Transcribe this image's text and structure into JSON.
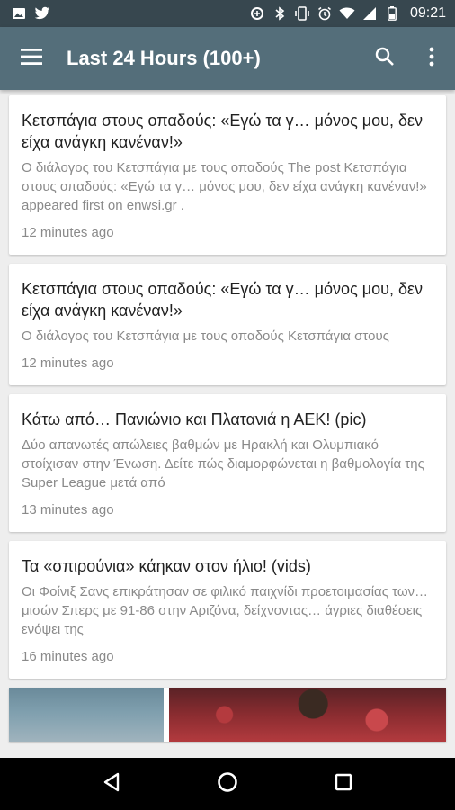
{
  "status_bar": {
    "time": "09:21",
    "left_icons": [
      "image-icon",
      "twitter-icon"
    ],
    "right_icons": [
      "data-saver-icon",
      "bluetooth-icon",
      "vibrate-icon",
      "alarm-icon",
      "wifi-icon",
      "signal-icon",
      "battery-icon"
    ]
  },
  "app_bar": {
    "title": "Last 24 Hours (100+)",
    "menu_icon": "hamburger-menu-icon",
    "search_icon": "search-icon",
    "more_icon": "more-vert-icon",
    "background": "#546e7a"
  },
  "feed": {
    "items": [
      {
        "title": "Κετσπάγια στους οπαδούς: «Εγώ τα γ… μόνος μου, δεν είχα ανάγκη κανέναν!»",
        "summary": "Ο διάλογος του Κετσπάγια με τους οπαδούς The post Κετσπάγια στους οπαδούς: «Εγώ τα γ… μόνος μου, δεν είχα ανάγκη κανέναν!» appeared first on enwsi.gr .",
        "time": "12 minutes ago"
      },
      {
        "title": "Κετσπάγια στους οπαδούς: «Εγώ τα γ… μόνος μου, δεν είχα ανάγκη κανέναν!»",
        "summary": "Ο διάλογος του Κετσπάγια με τους οπαδούς Κετσπάγια στους",
        "time": "12 minutes ago"
      },
      {
        "title": "Κάτω από… Πανιώνιο και Πλατανιά η ΑΕΚ! (pic)",
        "summary": "Δύο απανωτές απώλειες βαθμών με Ηρακλή και Ολυμπιακό στοίχισαν στην Ένωση. Δείτε πώς διαμορφώνεται η βαθμολογία της Super League μετά από",
        "time": "13 minutes ago"
      },
      {
        "title": "Τα «σπιρούνια» κάηκαν στον ήλιο! (vids)",
        "summary": "Οι Φοίνιξ Σανς επικράτησαν σε φιλικό παιχνίδι προετοιμασίας των… μισών Σπερς με 91-86 στην Αριζόνα, δείχνοντας… άγριες διαθέσεις ενόψει της",
        "time": "16 minutes ago"
      }
    ]
  },
  "nav_bar": {
    "back_icon": "back-triangle-icon",
    "home_icon": "home-circle-icon",
    "recents_icon": "recents-square-icon"
  }
}
